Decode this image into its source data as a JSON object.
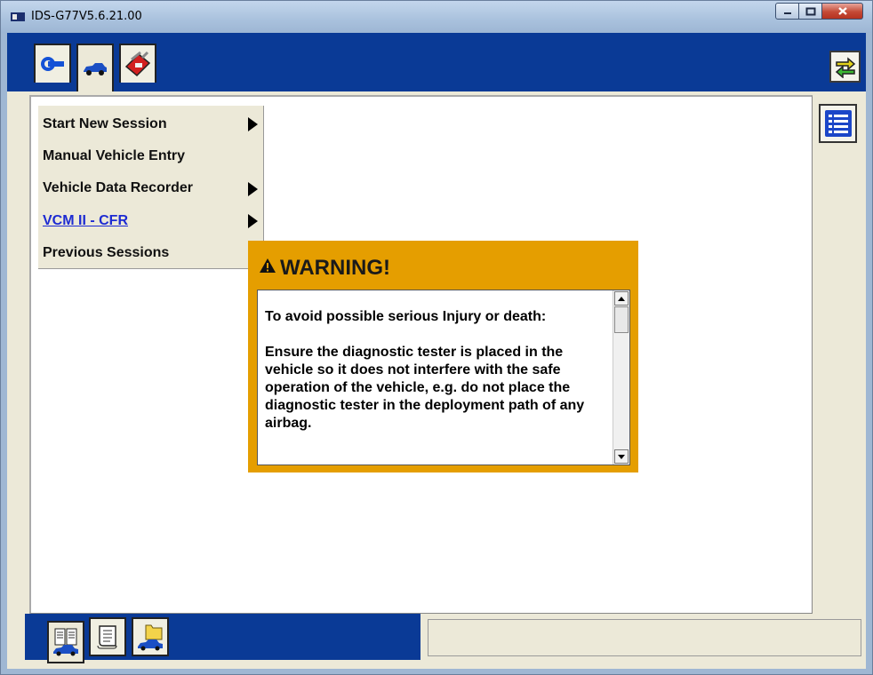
{
  "window": {
    "title": "IDS-G77V5.6.21.00"
  },
  "toolbar": {
    "tabs": [
      {
        "icon": "connector-icon"
      },
      {
        "icon": "vehicle-icon"
      },
      {
        "icon": "toolbox-icon"
      }
    ],
    "swap_icon": "swap-arrows-icon"
  },
  "menu": {
    "items": [
      {
        "label": "Start New Session",
        "has_submenu": true
      },
      {
        "label": "Manual Vehicle Entry",
        "has_submenu": false
      },
      {
        "label": "Vehicle Data Recorder",
        "has_submenu": true
      },
      {
        "label": "VCM II - CFR",
        "has_submenu": true,
        "link": true
      },
      {
        "label": "Previous Sessions",
        "has_submenu": false
      }
    ]
  },
  "warning": {
    "title": "WARNING!",
    "paragraphs": [
      "To avoid possible serious Injury or death:",
      "Ensure the diagnostic tester is placed in the vehicle so it does not interfere with the safe operation of the vehicle, e.g. do not place the diagnostic tester in the deployment path of any airbag."
    ]
  },
  "bottom": {
    "tabs": [
      {
        "icon": "vehicle-data-icon"
      },
      {
        "icon": "document-scroll-icon"
      },
      {
        "icon": "folder-vehicle-icon"
      }
    ],
    "status_text": ""
  },
  "colors": {
    "toolbar_blue": "#0a3a96",
    "warning_orange": "#e59e00",
    "panel_beige": "#ece9d8",
    "link_blue": "#1d2bd2"
  }
}
